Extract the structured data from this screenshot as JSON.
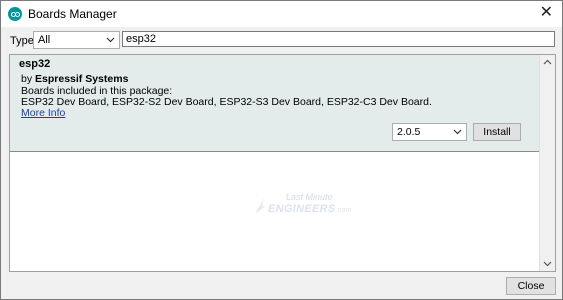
{
  "window": {
    "title": "Boards Manager",
    "close_glyph": "✕"
  },
  "filter": {
    "type_label": "Type",
    "type_value": "All",
    "search_value": "esp32"
  },
  "entry": {
    "name": "esp32",
    "by_prefix": "by ",
    "author": "Espressif Systems",
    "included_label": "Boards included in this package:",
    "boards": "ESP32 Dev Board, ESP32-S2 Dev Board, ESP32-S3 Dev Board, ESP32-C3 Dev Board.",
    "more_info": "More Info",
    "version": "2.0.5",
    "install_label": "Install"
  },
  "watermark": {
    "line1": "Last Minute",
    "line2": "ENGINEERS",
    "line2_suffix": ".com"
  },
  "footer": {
    "close_label": "Close"
  },
  "colors": {
    "entry_bg": "#e3ecea",
    "link": "#1f3ea8",
    "app_icon": "#00979c"
  }
}
